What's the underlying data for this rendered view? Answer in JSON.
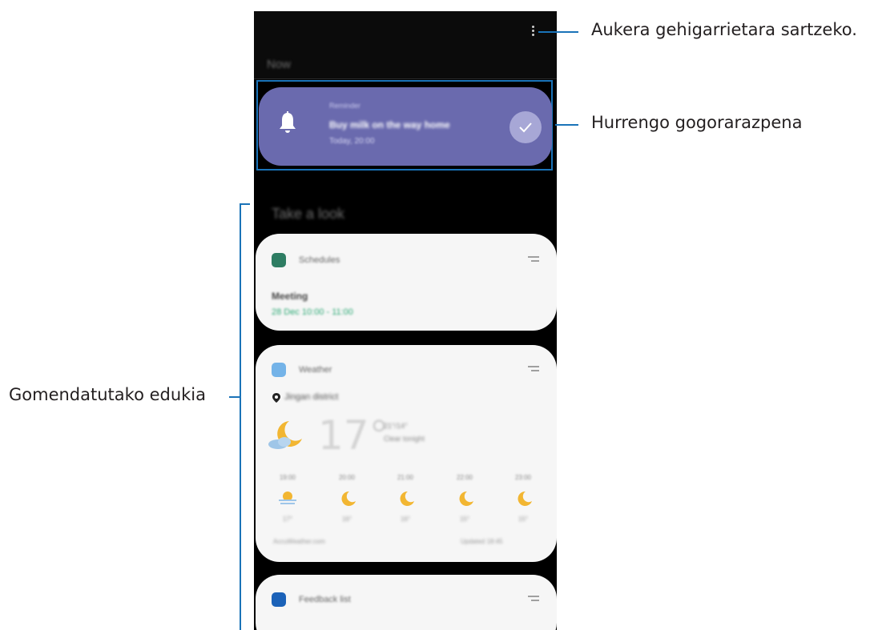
{
  "callouts": {
    "more_options": "Aukera gehigarrietara sartzeko.",
    "next_reminder": "Hurrengo gogorarazpena",
    "recommended": "Gomendatutako edukia"
  },
  "phone": {
    "section_now": "Now",
    "reminder": {
      "label": "Reminder",
      "title": "Buy milk on the way home",
      "subtitle": "Today, 20:00"
    },
    "section_look": "Take a look",
    "schedules_card": {
      "title": "Schedules",
      "event": "Meeting",
      "time": "28 Dec 10:00 - 11:00"
    },
    "weather_card": {
      "title": "Weather",
      "location": "Jingan district",
      "temperature": "17°",
      "detail_line1": "21°/14°",
      "detail_line2": "Clear tonight",
      "hourly": [
        {
          "time": "19:00",
          "icon": "sun-cloud-icon",
          "temp": "17°"
        },
        {
          "time": "20:00",
          "icon": "moon-icon",
          "temp": "16°"
        },
        {
          "time": "21:00",
          "icon": "moon-icon",
          "temp": "16°"
        },
        {
          "time": "22:00",
          "icon": "moon-icon",
          "temp": "15°"
        },
        {
          "time": "23:00",
          "icon": "moon-icon",
          "temp": "15°"
        }
      ],
      "footer_left": "AccuWeather.com",
      "footer_right": "Updated 18:45"
    },
    "feedback_card": {
      "title": "Feedback list"
    }
  },
  "colors": {
    "callout_line": "#1a73b8",
    "reminder_bg": "#6a6aae",
    "card_bg": "#f6f6f6",
    "schedule_icon": "#2e7d63",
    "weather_icon": "#74b3e8",
    "feedback_icon": "#1b62b8"
  }
}
